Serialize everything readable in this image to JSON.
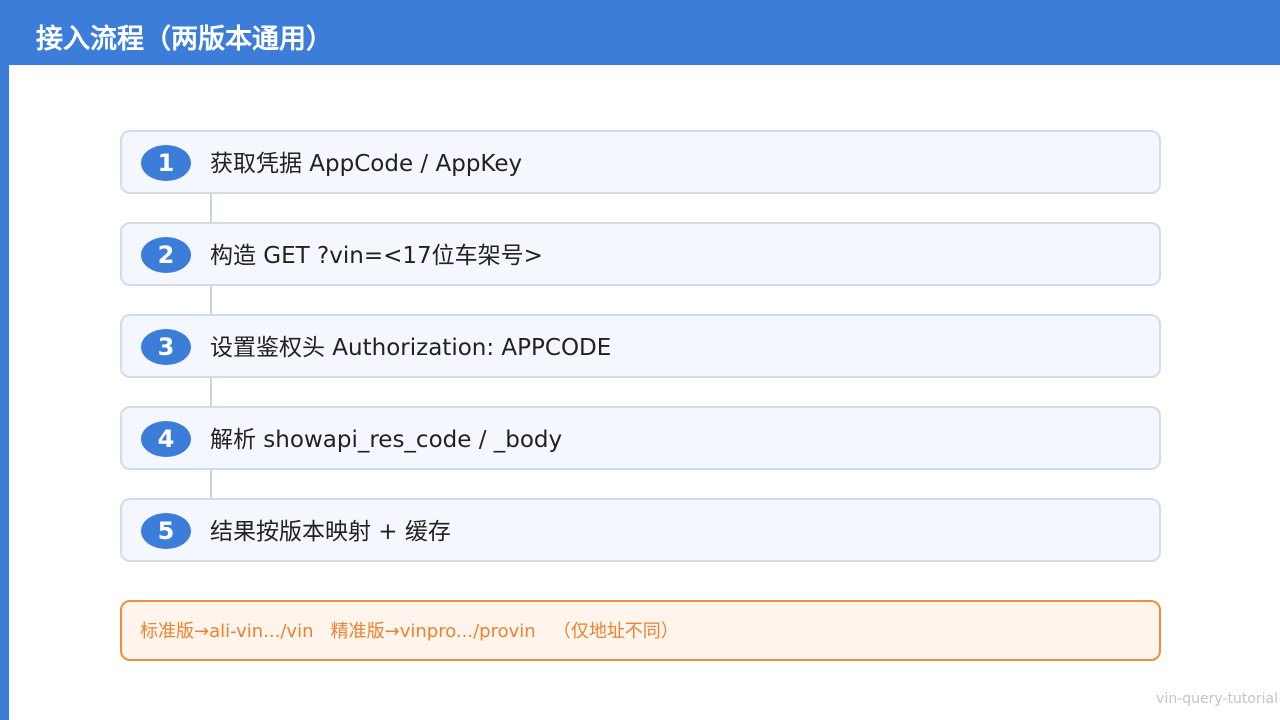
{
  "header": {
    "title": "接入流程（两版本通用）"
  },
  "steps": [
    {
      "num": "1",
      "text": "获取凭据 AppCode / AppKey"
    },
    {
      "num": "2",
      "text": "构造 GET ?vin=<17位车架号>"
    },
    {
      "num": "3",
      "text": "设置鉴权头 Authorization: APPCODE"
    },
    {
      "num": "4",
      "text": "解析 showapi_res_code / _body"
    },
    {
      "num": "5",
      "text": "结果按版本映射 + 缓存"
    }
  ],
  "note": {
    "text": "标准版→ali-vin.../vin   精准版→vinpro.../provin   （仅地址不同）"
  },
  "footer": {
    "tag": "vin-query-tutorial"
  },
  "colors": {
    "accent": "#3b7dd8",
    "note": "#ef8d3f"
  }
}
